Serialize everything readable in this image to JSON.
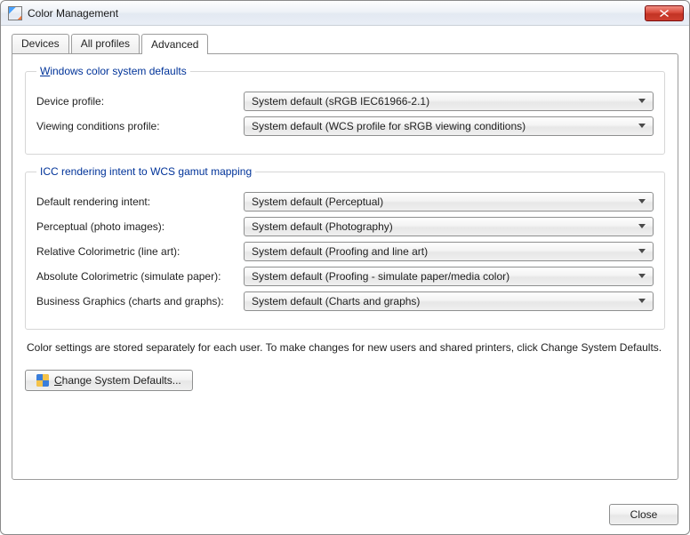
{
  "window": {
    "title": "Color Management",
    "close_label": "Close"
  },
  "tabs": {
    "devices": "Devices",
    "all_profiles": "All profiles",
    "advanced": "Advanced",
    "active": "advanced"
  },
  "group_wcsd": {
    "legend": "Windows color system defaults",
    "device_profile_label": "Device profile:",
    "device_profile_value": "System default (sRGB IEC61966-2.1)",
    "viewing_conditions_label": "Viewing conditions profile:",
    "viewing_conditions_value": "System default (WCS profile for sRGB viewing conditions)"
  },
  "group_icc": {
    "legend": "ICC  rendering intent to WCS gamut mapping",
    "default_intent_label": "Default rendering intent:",
    "default_intent_value": "System default (Perceptual)",
    "perceptual_label": "Perceptual (photo images):",
    "perceptual_value": "System default (Photography)",
    "relcol_label": "Relative Colorimetric (line art):",
    "relcol_value": "System default (Proofing and line art)",
    "abscol_label": "Absolute Colorimetric (simulate paper):",
    "abscol_value": "System default (Proofing - simulate paper/media color)",
    "bizgfx_label": "Business Graphics (charts and graphs):",
    "bizgfx_value": "System default (Charts and graphs)"
  },
  "note_text": "Color settings are stored separately for each user. To make changes for new users and shared printers, click Change System Defaults.",
  "change_defaults_label": "Change System Defaults...",
  "close_button_label": "Close"
}
